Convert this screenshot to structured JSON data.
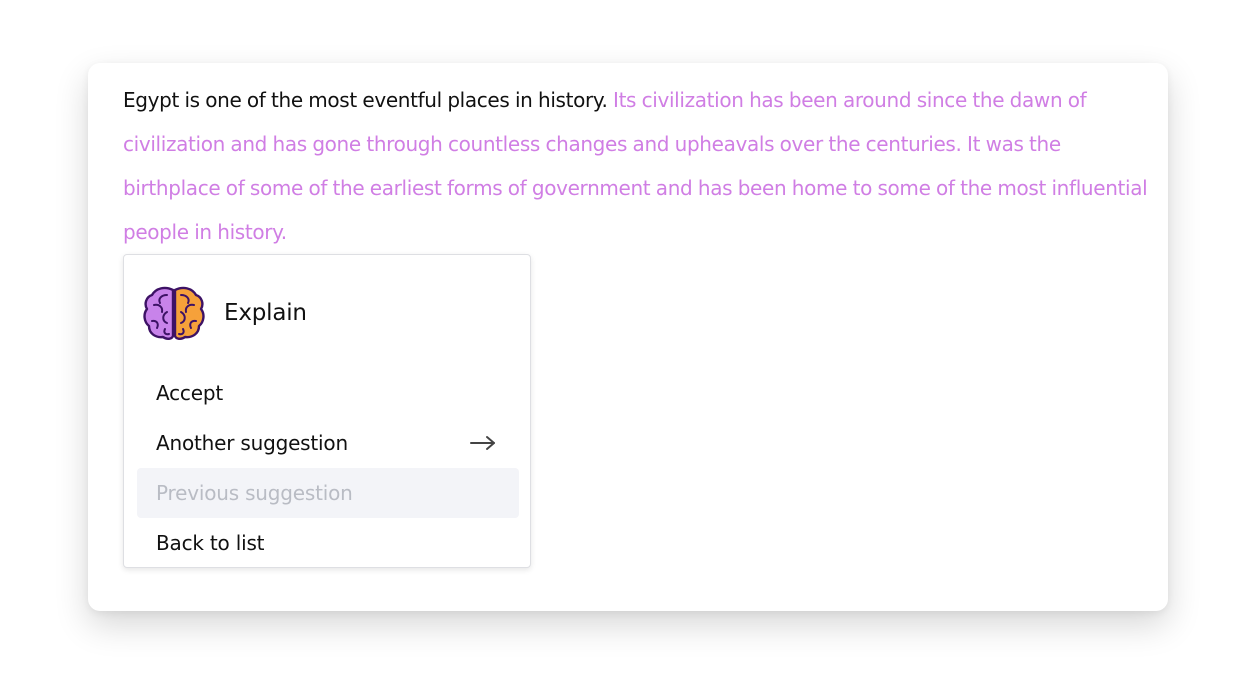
{
  "editor": {
    "text_plain": "Egypt is one of the most eventful places in history.",
    "text_suggestion": "Its civilization has been around since the dawn of civilization and has gone through countless changes and upheavals over the centuries. It was the birthplace of some of the earliest forms of government and has been home to some of the most influential people in history."
  },
  "menu": {
    "title": "Explain",
    "icon": "brain-icon",
    "items": [
      {
        "label": "Accept",
        "disabled": false
      },
      {
        "label": "Another suggestion",
        "disabled": false,
        "icon": "arrow-right-icon"
      },
      {
        "label": "Previous suggestion",
        "disabled": true
      },
      {
        "label": "Back to list",
        "disabled": false
      }
    ]
  },
  "colors": {
    "suggestion_text": "#d07ee4",
    "disabled_background": "#f3f4f8",
    "disabled_text": "#b9bcc4",
    "brain_left": "#c883ea",
    "brain_right": "#f6a13a",
    "brain_outline": "#3d1265"
  }
}
